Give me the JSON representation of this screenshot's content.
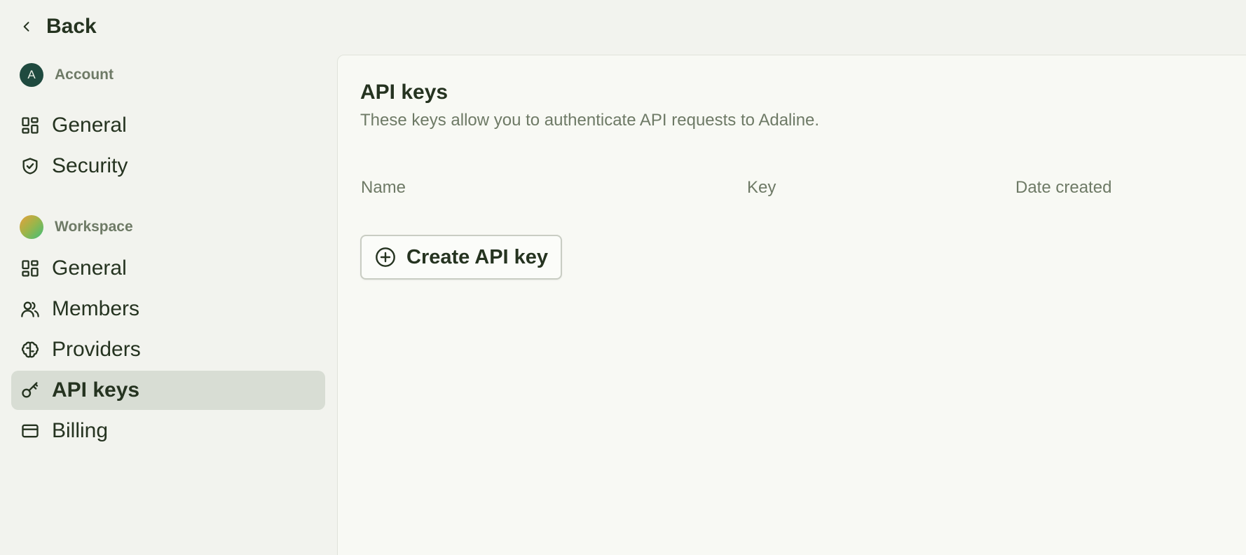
{
  "back": {
    "label": "Back",
    "icon": "chevron-left-icon"
  },
  "sidebar": {
    "account": {
      "avatar_letter": "A",
      "title": "Account",
      "items": [
        {
          "label": "General",
          "icon": "dashboard-icon"
        },
        {
          "label": "Security",
          "icon": "shield-check-icon"
        }
      ]
    },
    "workspace": {
      "title": "Workspace",
      "items": [
        {
          "label": "General",
          "icon": "dashboard-icon"
        },
        {
          "label": "Members",
          "icon": "users-icon"
        },
        {
          "label": "Providers",
          "icon": "brain-icon"
        },
        {
          "label": "API keys",
          "icon": "key-icon",
          "active": true
        },
        {
          "label": "Billing",
          "icon": "credit-card-icon"
        }
      ]
    }
  },
  "main": {
    "title": "API keys",
    "subtitle": "These keys allow you to authenticate API requests to Adaline.",
    "columns": [
      "Name",
      "Key",
      "Date created"
    ],
    "create_button": {
      "label": "Create API key",
      "icon": "plus-circle-icon"
    }
  },
  "colors": {
    "background": "#f2f3ee",
    "panel": "#f8f9f4",
    "text": "#253320",
    "muted": "#6e7a66",
    "active_item": "#d8ddd4",
    "account_avatar": "#1f4a3f"
  }
}
